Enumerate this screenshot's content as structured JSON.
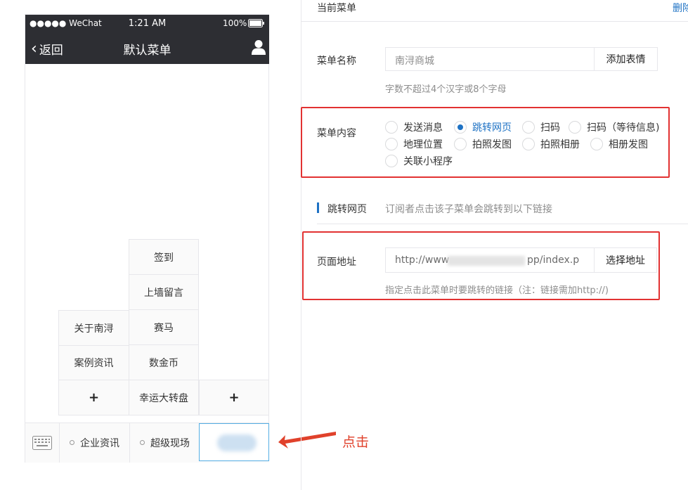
{
  "phone": {
    "status_bar": {
      "carrier": "●●●●● WeChat",
      "time": "1:21 AM",
      "battery": "100%"
    },
    "back_label": "返回",
    "title": "默认菜单",
    "user_icon": "user-icon",
    "submenu_2": [
      "关于南浔",
      "案例资讯",
      "+"
    ],
    "submenu_3": [
      "签到",
      "上墙留言",
      "赛马",
      "数金币",
      "幸运大转盘"
    ],
    "submenu_4_add": "+",
    "bottom_menu": [
      {
        "label": "企业资讯"
      },
      {
        "label": "超级现场"
      }
    ],
    "keyboard_icon": "keyboard-icon"
  },
  "annotation": {
    "click_label": "点击",
    "color": "#e0412b"
  },
  "editor": {
    "current_menu_label": "当前菜单",
    "delete_label": "删除",
    "name_row": {
      "label": "菜单名称",
      "value": "南浔商城",
      "emoji_button": "添加表情",
      "hint": "字数不超过4个汉字或8个字母"
    },
    "content_row": {
      "label": "菜单内容",
      "options": [
        {
          "label": "发送消息",
          "checked": false
        },
        {
          "label": "跳转网页",
          "checked": true
        },
        {
          "label": "扫码",
          "checked": false
        },
        {
          "label": "扫码（等待信息)",
          "checked": false
        },
        {
          "label": "地理位置",
          "checked": false
        },
        {
          "label": "拍照发图",
          "checked": false
        },
        {
          "label": "拍照相册",
          "checked": false
        },
        {
          "label": "相册发图",
          "checked": false
        },
        {
          "label": "关联小程序",
          "checked": false
        }
      ]
    },
    "section": {
      "title": "跳转网页",
      "description": "订阅者点击该子菜单会跳转到以下链接"
    },
    "url_row": {
      "label": "页面地址",
      "value_prefix": "http://www",
      "value_suffix": "pp/index.p",
      "select_button": "选择地址",
      "hint": "指定点击此菜单时要跳转的链接（注：链接需加http://)"
    },
    "colors": {
      "accent": "#1e72c4",
      "highlight_border": "#e23232",
      "header_bg": "#2d2e33"
    }
  }
}
